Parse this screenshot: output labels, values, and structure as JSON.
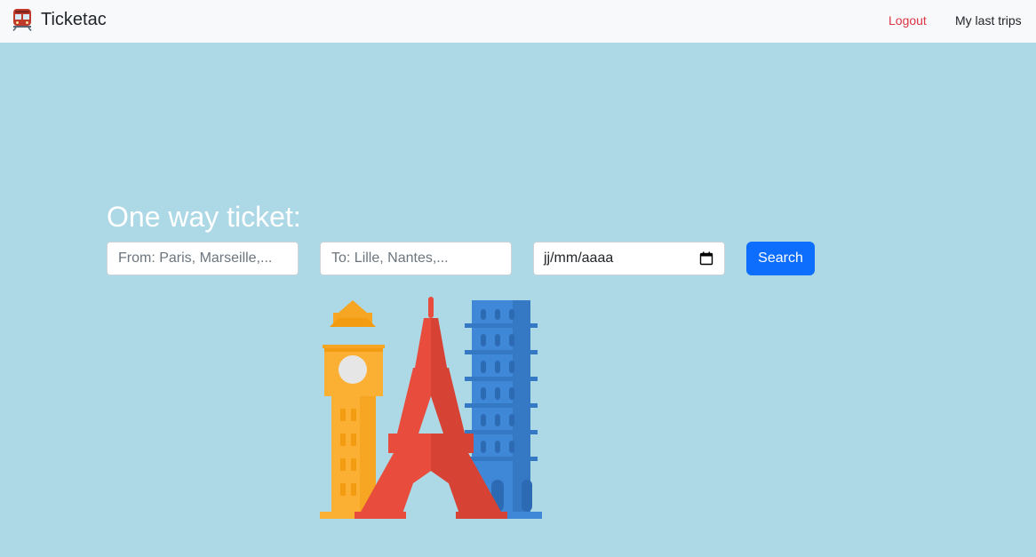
{
  "navbar": {
    "brand": "Ticketac",
    "brand_icon": "train-icon",
    "links": {
      "logout": "Logout",
      "last_trips": "My last trips"
    }
  },
  "search": {
    "title": "One way ticket:",
    "from_placeholder": "From: Paris, Marseille,...",
    "to_placeholder": "To: Lille, Nantes,...",
    "date_placeholder": "jj/mm/aaaa",
    "button_label": "Search"
  },
  "illustration": {
    "icon": "landmarks-illustration"
  },
  "colors": {
    "background": "#add8e6",
    "navbar": "#f8f9fa",
    "logout": "#dc3545",
    "primary": "#0d6efd"
  }
}
